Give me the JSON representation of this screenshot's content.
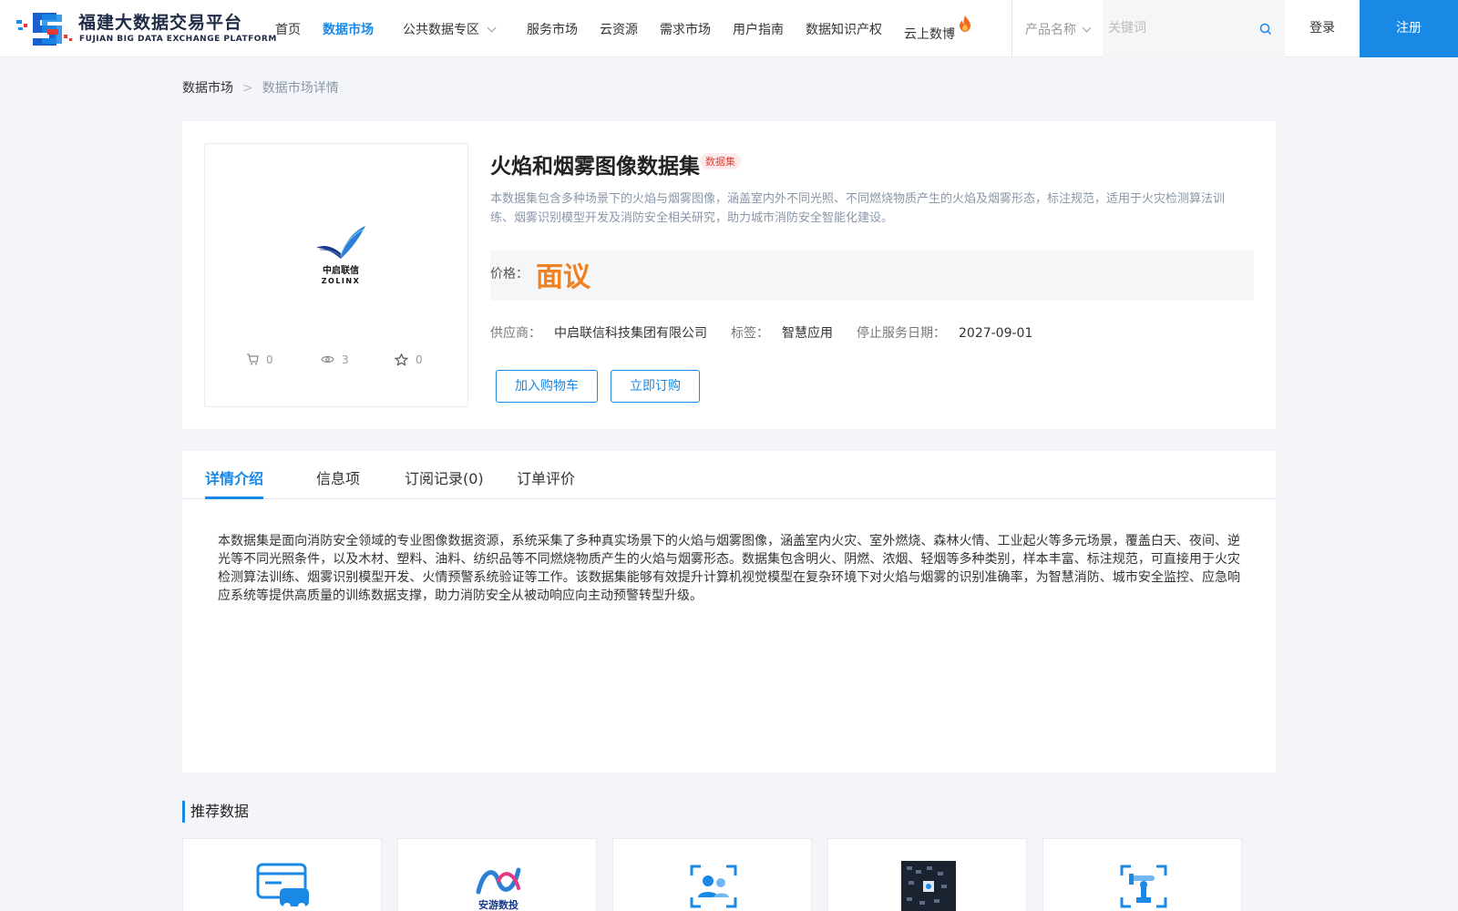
{
  "header": {
    "logo_cn": "福建大数据交易平台",
    "logo_en": "FUJIAN BIG DATA EXCHANGE PLATFORM",
    "nav": [
      {
        "label": "首页",
        "active": false
      },
      {
        "label": "数据市场",
        "active": true
      },
      {
        "label": "公共数据专区",
        "active": false
      },
      {
        "label": "服务市场",
        "active": false
      },
      {
        "label": "云资源",
        "active": false
      },
      {
        "label": "需求市场",
        "active": false
      },
      {
        "label": "用户指南",
        "active": false
      },
      {
        "label": "数据知识产权",
        "active": false
      },
      {
        "label": "云上数博",
        "active": false
      }
    ],
    "search_type": "产品名称",
    "search_placeholder": "关键词",
    "login": "登录",
    "register": "注册",
    "accent_color": "#1a89e6"
  },
  "breadcrumb": {
    "root": "数据市场",
    "separator": ">",
    "current": "数据市场详情"
  },
  "product": {
    "vendor_logo_cn": "中启联信",
    "vendor_logo_en": "ZOLINX",
    "stats": {
      "cart": "0",
      "views": "3",
      "favorites": "0"
    },
    "title": "火焰和烟雾图像数据集",
    "badge": "数据集",
    "description": "本数据集包含多种场景下的火焰与烟雾图像，涵盖室内外不同光照、不同燃烧物质产生的火焰及烟雾形态，标注规范，适用于火灾检测算法训练、烟雾识别模型开发及消防安全相关研究，助力城市消防安全智能化建设。",
    "price_label": "价格：",
    "price_value": "面议",
    "price_color": "#f0811f",
    "supplier_label": "供应商：",
    "supplier": "中启联信科技集团有限公司",
    "tag_label": "标签：",
    "tag": "智慧应用",
    "end_date_label": "停止服务日期：",
    "end_date": "2027-09-01",
    "add_cart": "加入购物车",
    "buy_now": "立即订购"
  },
  "tabs": {
    "items": [
      "详情介绍",
      "信息项",
      "订阅记录(0)",
      "订单评价"
    ],
    "active_index": 0,
    "detail_text": "本数据集是面向消防安全领域的专业图像数据资源，系统采集了多种真实场景下的火焰与烟雾图像，涵盖室内火灾、室外燃烧、森林火情、工业起火等多元场景，覆盖白天、夜间、逆光等不同光照条件，以及木材、塑料、油料、纺织品等不同燃烧物质产生的火焰与烟雾形态。数据集包含明火、阴燃、浓烟、轻烟等多种类别，样本丰富、标注规范，可直接用于火灾检测算法训练、烟雾识别模型开发、火情预警系统验证等工作。该数据集能够有效提升计算机视觉模型在复杂环境下对火焰与烟雾的识别准确率，为智慧消防、城市安全监控、应急响应系统等提供高质量的训练数据支撑，助力消防安全从被动响应向主动预警转型升级。"
  },
  "recommend": {
    "title": "推荐数据",
    "cards": [
      {
        "icon": "car-card-icon"
      },
      {
        "icon": "anyou-logo-icon",
        "logo_text": "安游数投"
      },
      {
        "icon": "users-scan-icon"
      },
      {
        "icon": "circuit-board-icon"
      },
      {
        "icon": "robot-arm-icon"
      }
    ]
  }
}
